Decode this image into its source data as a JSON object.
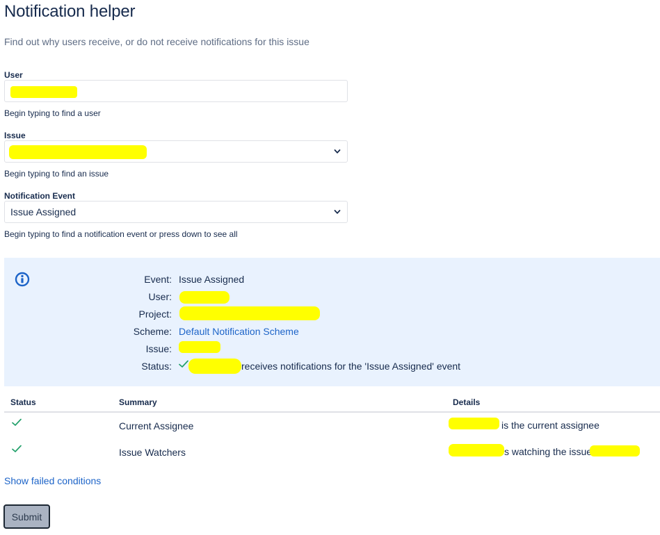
{
  "page": {
    "title": "Notification helper",
    "description": "Find out why users receive, or do not receive notifications for this issue"
  },
  "form": {
    "user": {
      "label": "User",
      "value": "",
      "help": "Begin typing to find a user"
    },
    "issue": {
      "label": "Issue",
      "value": "",
      "help": "Begin typing to find an issue"
    },
    "event": {
      "label": "Notification Event",
      "value": "Issue Assigned",
      "help": "Begin typing to find a notification event or press down to see all"
    }
  },
  "result": {
    "labels": {
      "event": "Event:",
      "user": "User:",
      "project": "Project:",
      "scheme": "Scheme:",
      "issue": "Issue:",
      "status": "Status:"
    },
    "event": "Issue Assigned",
    "scheme": "Default Notification Scheme",
    "status_text": "receives notifications for the 'Issue Assigned' event"
  },
  "table": {
    "headers": [
      "Status",
      "Summary",
      "Details"
    ],
    "rows": [
      {
        "summary": "Current Assignee",
        "details": "is the current assignee"
      },
      {
        "summary": "Issue Watchers",
        "details": "s watching the issue"
      }
    ]
  },
  "links": {
    "show_failed": "Show failed conditions"
  },
  "buttons": {
    "submit": "Submit"
  },
  "colors": {
    "text": "#172b4d",
    "link": "#1d64c8",
    "info_bg": "#e9f2fe",
    "success": "#22a06b",
    "redaction": "#ffff00"
  },
  "icons": {
    "info": "info-icon",
    "check": "check-icon",
    "chevron": "chevron-down-icon"
  }
}
